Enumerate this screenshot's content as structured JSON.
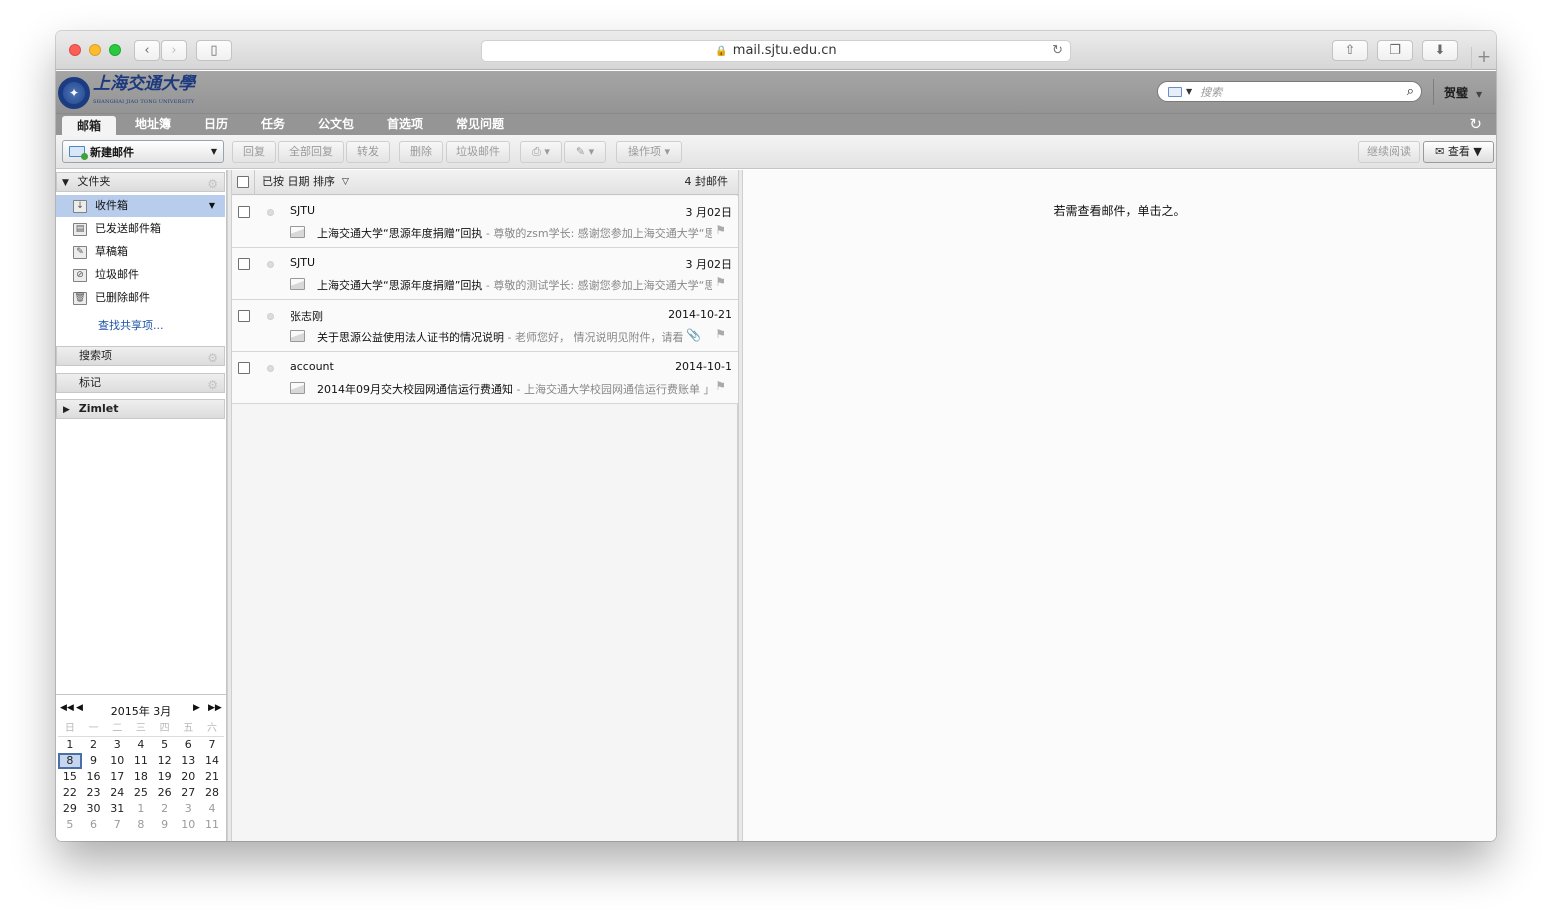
{
  "browser": {
    "url": "mail.sjtu.edu.cn",
    "new_tab": "+"
  },
  "header": {
    "logo_text": "上海交通大學",
    "logo_subtext": "SHANGHAI JIAO TONG UNIVERSITY",
    "search_placeholder": "搜索",
    "user_name": "贺璧"
  },
  "nav_tabs": [
    "邮箱",
    "地址簿",
    "日历",
    "任务",
    "公文包",
    "首选项",
    "常见问题"
  ],
  "toolbar": {
    "new_mail": "新建邮件",
    "reply": "回复",
    "reply_all": "全部回复",
    "forward": "转发",
    "delete": "删除",
    "spam": "垃圾邮件",
    "actions": "操作项",
    "continue_reading": "继续阅读",
    "view": "查看"
  },
  "sidebar": {
    "folders_header": "文件夹",
    "folders": [
      {
        "label": "收件箱",
        "icon": "inbox-icon"
      },
      {
        "label": "已发送邮件箱",
        "icon": "sent-icon"
      },
      {
        "label": "草稿箱",
        "icon": "drafts-icon"
      },
      {
        "label": "垃圾邮件",
        "icon": "junk-icon"
      },
      {
        "label": "已删除邮件",
        "icon": "trash-icon"
      }
    ],
    "find_shared": "查找共享项...",
    "searches_header": "搜索项",
    "tags_header": "标记",
    "zimlet_header": "Zimlet"
  },
  "calendar": {
    "title": "2015年 3月",
    "weekdays": [
      "日",
      "一",
      "二",
      "三",
      "四",
      "五",
      "六"
    ],
    "weeks": [
      [
        "1",
        "2",
        "3",
        "4",
        "5",
        "6",
        "7"
      ],
      [
        "8",
        "9",
        "10",
        "11",
        "12",
        "13",
        "14"
      ],
      [
        "15",
        "16",
        "17",
        "18",
        "19",
        "20",
        "21"
      ],
      [
        "22",
        "23",
        "24",
        "25",
        "26",
        "27",
        "28"
      ],
      [
        "29",
        "30",
        "31",
        "1",
        "2",
        "3",
        "4"
      ],
      [
        "5",
        "6",
        "7",
        "8",
        "9",
        "10",
        "11"
      ]
    ],
    "today": "8"
  },
  "mail_list": {
    "sort_label": "已按 日期 排序",
    "count_label": "4 封邮件",
    "rows": [
      {
        "from": "SJTU",
        "date": "3 月02日",
        "subject": "上海交通大学“思源年度捐赠”回执",
        "fragment": " - 尊敬的zsm学长: 感谢您参加上海交通大学“思"
      },
      {
        "from": "SJTU",
        "date": "3 月02日",
        "subject": "上海交通大学“思源年度捐赠”回执",
        "fragment": " - 尊敬的测试学长: 感谢您参加上海交通大学“思"
      },
      {
        "from": "张志刚",
        "date": "2014-10-21",
        "subject": "关于思源公益使用法人证书的情况说明",
        "fragment": " - 老师您好， 情况说明见附件，请看"
      },
      {
        "from": "account",
        "date": "2014-10-1",
        "subject": "2014年09月交大校园网通信运行费通知",
        "fragment": " - 上海交通大学校园网通信运行费账单 」"
      }
    ]
  },
  "reading_pane": {
    "message": "若需查看邮件，单击之。"
  }
}
